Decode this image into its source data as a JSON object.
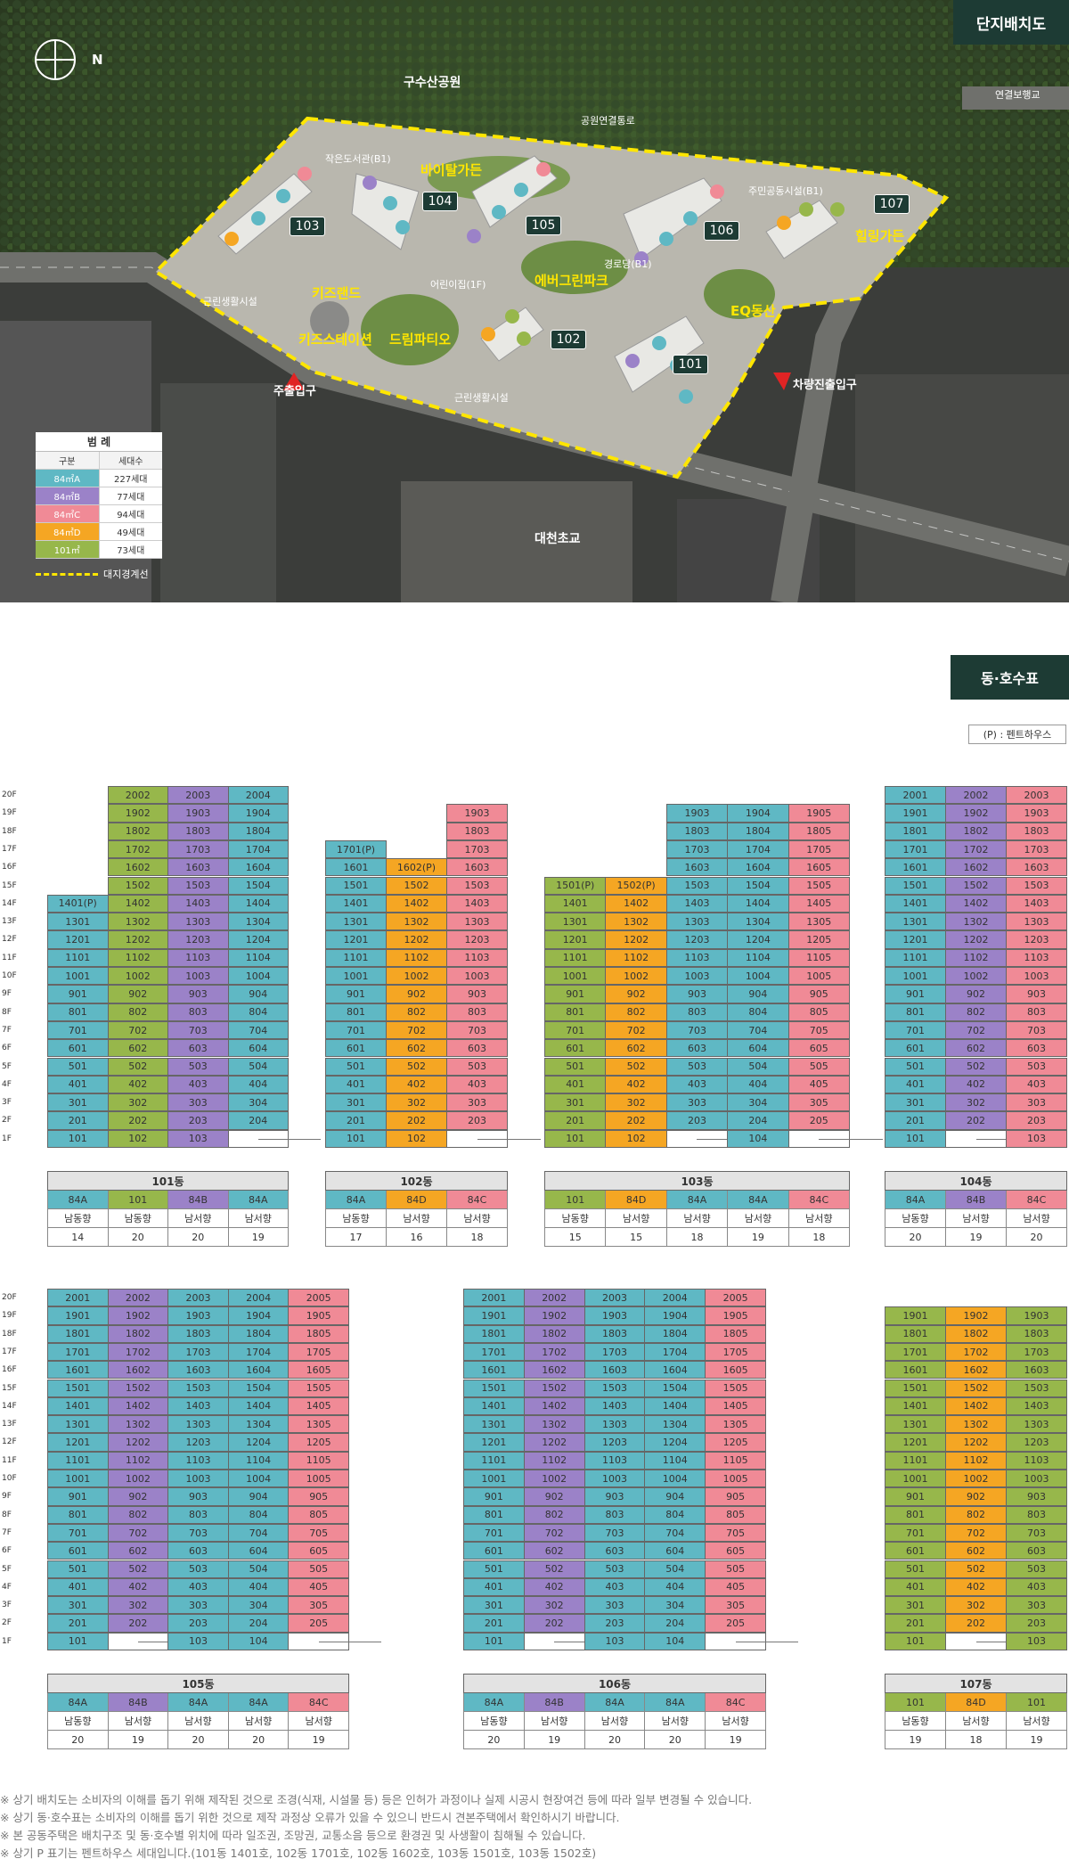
{
  "map": {
    "tag": "단지배치도",
    "compass": "N",
    "labels": {
      "park": "구수산공원",
      "bridge": "연결보행교",
      "park_path": "공원연결통로",
      "library": "작은도서관(B1)",
      "vital_garden": "바이탈가든",
      "community": "주민공동시설(B1)",
      "healing_garden": "힐링가든",
      "senior": "경로당(B1)",
      "ever_green": "에버그린파크",
      "daycare": "어린이집(1F)",
      "kids_land": "키즈랜드",
      "kids_station": "키즈스테이션",
      "dream_patio": "드림파티오",
      "eq_zone": "EQ동산",
      "near_fac_1": "근린생활시설",
      "near_fac_2": "근린생활시설",
      "main_entrance": "주출입구",
      "car_entrance": "차량진출입구",
      "school": "대천초교"
    },
    "buildings": [
      "103",
      "104",
      "105",
      "106",
      "107",
      "102",
      "101"
    ]
  },
  "legend": {
    "title": "범 례",
    "header": [
      "구분",
      "세대수"
    ],
    "rows": [
      {
        "type": "84㎡A",
        "count": "227세대",
        "color": "#5fb8c4"
      },
      {
        "type": "84㎡B",
        "count": "77세대",
        "color": "#9b82c8"
      },
      {
        "type": "84㎡C",
        "count": "94세대",
        "color": "#f08a96"
      },
      {
        "type": "84㎡D",
        "count": "49세대",
        "color": "#f5a623"
      },
      {
        "type": "101㎡",
        "count": "73세대",
        "color": "#97b74b"
      }
    ],
    "boundary": "대지경계선"
  },
  "units": {
    "tag": "동·호수표",
    "penthouse_note": "(P) : 펜트하우스",
    "buildings": [
      {
        "name": "101동",
        "cols": [
          {
            "line": "01",
            "type": "84A",
            "dir": "남동향",
            "n": "14",
            "from": 1,
            "to": 14,
            "ph": [
              14
            ],
            "empty": []
          },
          {
            "line": "02",
            "type": "101",
            "dir": "남동향",
            "n": "20",
            "from": 1,
            "to": 20,
            "ph": [],
            "empty": []
          },
          {
            "line": "03",
            "type": "84B",
            "dir": "남서향",
            "n": "20",
            "from": 1,
            "to": 20,
            "ph": [],
            "empty": []
          },
          {
            "line": "04",
            "type": "84A",
            "dir": "남서향",
            "n": "19",
            "from": 1,
            "to": 20,
            "ph": [],
            "empty": [
              1
            ]
          }
        ]
      },
      {
        "name": "102동",
        "cols": [
          {
            "line": "01",
            "type": "84A",
            "dir": "남동향",
            "n": "17",
            "from": 1,
            "to": 17,
            "ph": [
              17
            ],
            "empty": []
          },
          {
            "line": "02",
            "type": "84D",
            "dir": "남서향",
            "n": "16",
            "from": 1,
            "to": 16,
            "ph": [
              16
            ],
            "empty": []
          },
          {
            "line": "03",
            "type": "84C",
            "dir": "남서향",
            "n": "18",
            "from": 1,
            "to": 19,
            "ph": [],
            "empty": [
              1
            ]
          }
        ]
      },
      {
        "name": "103동",
        "cols": [
          {
            "line": "01",
            "type": "101",
            "dir": "남동향",
            "n": "15",
            "from": 1,
            "to": 15,
            "ph": [
              15
            ],
            "empty": []
          },
          {
            "line": "02",
            "type": "84D",
            "dir": "남서향",
            "n": "15",
            "from": 1,
            "to": 15,
            "ph": [
              15
            ],
            "empty": []
          },
          {
            "line": "03",
            "type": "84A",
            "dir": "남서향",
            "n": "18",
            "from": 1,
            "to": 19,
            "ph": [],
            "empty": [
              1
            ]
          },
          {
            "line": "04",
            "type": "84A",
            "dir": "남서향",
            "n": "19",
            "from": 1,
            "to": 19,
            "ph": [],
            "empty": []
          },
          {
            "line": "05",
            "type": "84C",
            "dir": "남서향",
            "n": "18",
            "from": 1,
            "to": 19,
            "ph": [],
            "empty": [
              1
            ]
          }
        ]
      },
      {
        "name": "104동",
        "cols": [
          {
            "line": "01",
            "type": "84A",
            "dir": "남동향",
            "n": "20",
            "from": 1,
            "to": 20,
            "ph": [],
            "empty": []
          },
          {
            "line": "02",
            "type": "84B",
            "dir": "남서향",
            "n": "19",
            "from": 1,
            "to": 20,
            "ph": [],
            "empty": [
              1
            ]
          },
          {
            "line": "03",
            "type": "84C",
            "dir": "남서향",
            "n": "20",
            "from": 1,
            "to": 20,
            "ph": [],
            "empty": []
          }
        ]
      },
      {
        "name": "105동",
        "cols": [
          {
            "line": "01",
            "type": "84A",
            "dir": "남동향",
            "n": "20",
            "from": 1,
            "to": 20,
            "ph": [],
            "empty": []
          },
          {
            "line": "02",
            "type": "84B",
            "dir": "남서향",
            "n": "19",
            "from": 1,
            "to": 20,
            "ph": [],
            "empty": [
              1
            ]
          },
          {
            "line": "03",
            "type": "84A",
            "dir": "남서향",
            "n": "20",
            "from": 1,
            "to": 20,
            "ph": [],
            "empty": []
          },
          {
            "line": "04",
            "type": "84A",
            "dir": "남서향",
            "n": "20",
            "from": 1,
            "to": 20,
            "ph": [],
            "empty": []
          },
          {
            "line": "05",
            "type": "84C",
            "dir": "남서향",
            "n": "19",
            "from": 1,
            "to": 20,
            "ph": [],
            "empty": [
              1
            ]
          }
        ]
      },
      {
        "name": "106동",
        "cols": [
          {
            "line": "01",
            "type": "84A",
            "dir": "남동향",
            "n": "20",
            "from": 1,
            "to": 20,
            "ph": [],
            "empty": []
          },
          {
            "line": "02",
            "type": "84B",
            "dir": "남서향",
            "n": "19",
            "from": 1,
            "to": 20,
            "ph": [],
            "empty": [
              1
            ]
          },
          {
            "line": "03",
            "type": "84A",
            "dir": "남서향",
            "n": "20",
            "from": 1,
            "to": 20,
            "ph": [],
            "empty": []
          },
          {
            "line": "04",
            "type": "84A",
            "dir": "남서향",
            "n": "20",
            "from": 1,
            "to": 20,
            "ph": [],
            "empty": []
          },
          {
            "line": "05",
            "type": "84C",
            "dir": "남서향",
            "n": "19",
            "from": 1,
            "to": 20,
            "ph": [],
            "empty": [
              1
            ]
          }
        ]
      },
      {
        "name": "107동",
        "cols": [
          {
            "line": "01",
            "type": "101",
            "dir": "남동향",
            "n": "19",
            "from": 1,
            "to": 19,
            "ph": [],
            "empty": []
          },
          {
            "line": "02",
            "type": "84D",
            "dir": "남서향",
            "n": "18",
            "from": 1,
            "to": 19,
            "ph": [],
            "empty": [
              1
            ]
          },
          {
            "line": "03",
            "type": "101",
            "dir": "남서향",
            "n": "19",
            "from": 1,
            "to": 19,
            "ph": [],
            "empty": []
          }
        ]
      }
    ]
  },
  "notes": [
    "※ 상기 배치도는 소비자의 이해를 돕기 위해 제작된 것으로 조경(식재, 시설물 등) 등은 인허가 과정이나 실제 시공시 현장여건 등에 따라 일부 변경될 수 있습니다.",
    "※ 상기 동·호수표는 소비자의 이해를 돕기 위한 것으로 제작 과정상 오류가 있을 수 있으니 반드시 견본주택에서 확인하시기 바랍니다.",
    "※ 본 공동주택은 배치구조 및 동·호수별 위치에 따라 일조권, 조망권, 교통소음 등으로 환경권 및 사생활이 침해될 수 있습니다.",
    "※ 상기 P 표기는 펜트하우스 세대입니다.(101동 1401호, 102동 1701호, 102동 1602호, 103동 1501호, 103동 1502호)"
  ]
}
